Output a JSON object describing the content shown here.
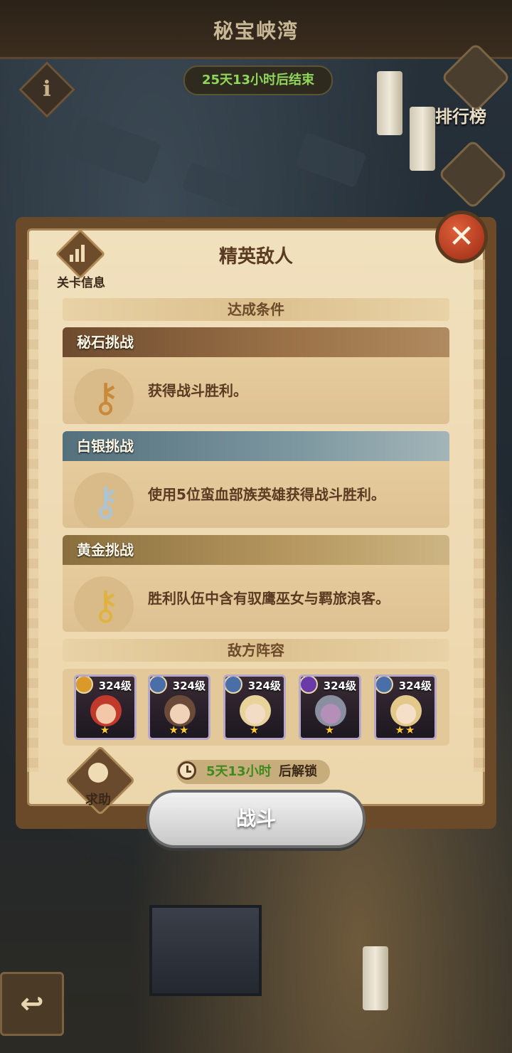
{
  "map": {
    "title": "秘宝峡湾",
    "timer": "25天13小时后结束",
    "info_symbol": "i",
    "ranking_label": "排行榜"
  },
  "panel": {
    "title": "精英敌人",
    "stage_info_label": "关卡信息",
    "close_symbol": "✕",
    "conditions_header": "达成条件",
    "challenges": [
      {
        "tier": "bronze",
        "title": "秘石挑战",
        "description": "获得战斗胜利。",
        "key_icon": "bronze-key-icon",
        "key_color": "#c88a3a"
      },
      {
        "tier": "silver",
        "title": "白银挑战",
        "description": "使用5位蛮血部族英雄获得战斗胜利。",
        "key_icon": "silver-key-icon",
        "key_color": "#aac4d8"
      },
      {
        "tier": "gold",
        "title": "黄金挑战",
        "description": "胜利队伍中含有驭鹰巫女与羁旅浪客。",
        "key_icon": "gold-key-icon",
        "key_color": "#e0b341"
      }
    ],
    "enemy_header": "敌方阵容",
    "heroes": [
      {
        "level": "324级",
        "stars": "★",
        "faction_color": "#d99a2a",
        "hair_color": "#c0392b"
      },
      {
        "level": "324级",
        "stars": "★★",
        "faction_color": "#4a6fa8",
        "hair_color": "#6b4a3a"
      },
      {
        "level": "324级",
        "stars": "★",
        "faction_color": "#4a6fa8",
        "hair_color": "#e8d39a"
      },
      {
        "level": "324级",
        "stars": "★",
        "faction_color": "#6a3aa8",
        "hair_color": "#8a8fa0"
      },
      {
        "level": "324级",
        "stars": "★★",
        "faction_color": "#4a6fa8",
        "hair_color": "#e2c98a"
      }
    ],
    "help_label": "求助",
    "unlock_time": "5天13小时",
    "unlock_suffix": "后解锁",
    "fight_label": "战斗"
  },
  "nav": {
    "back_symbol": "↩"
  }
}
